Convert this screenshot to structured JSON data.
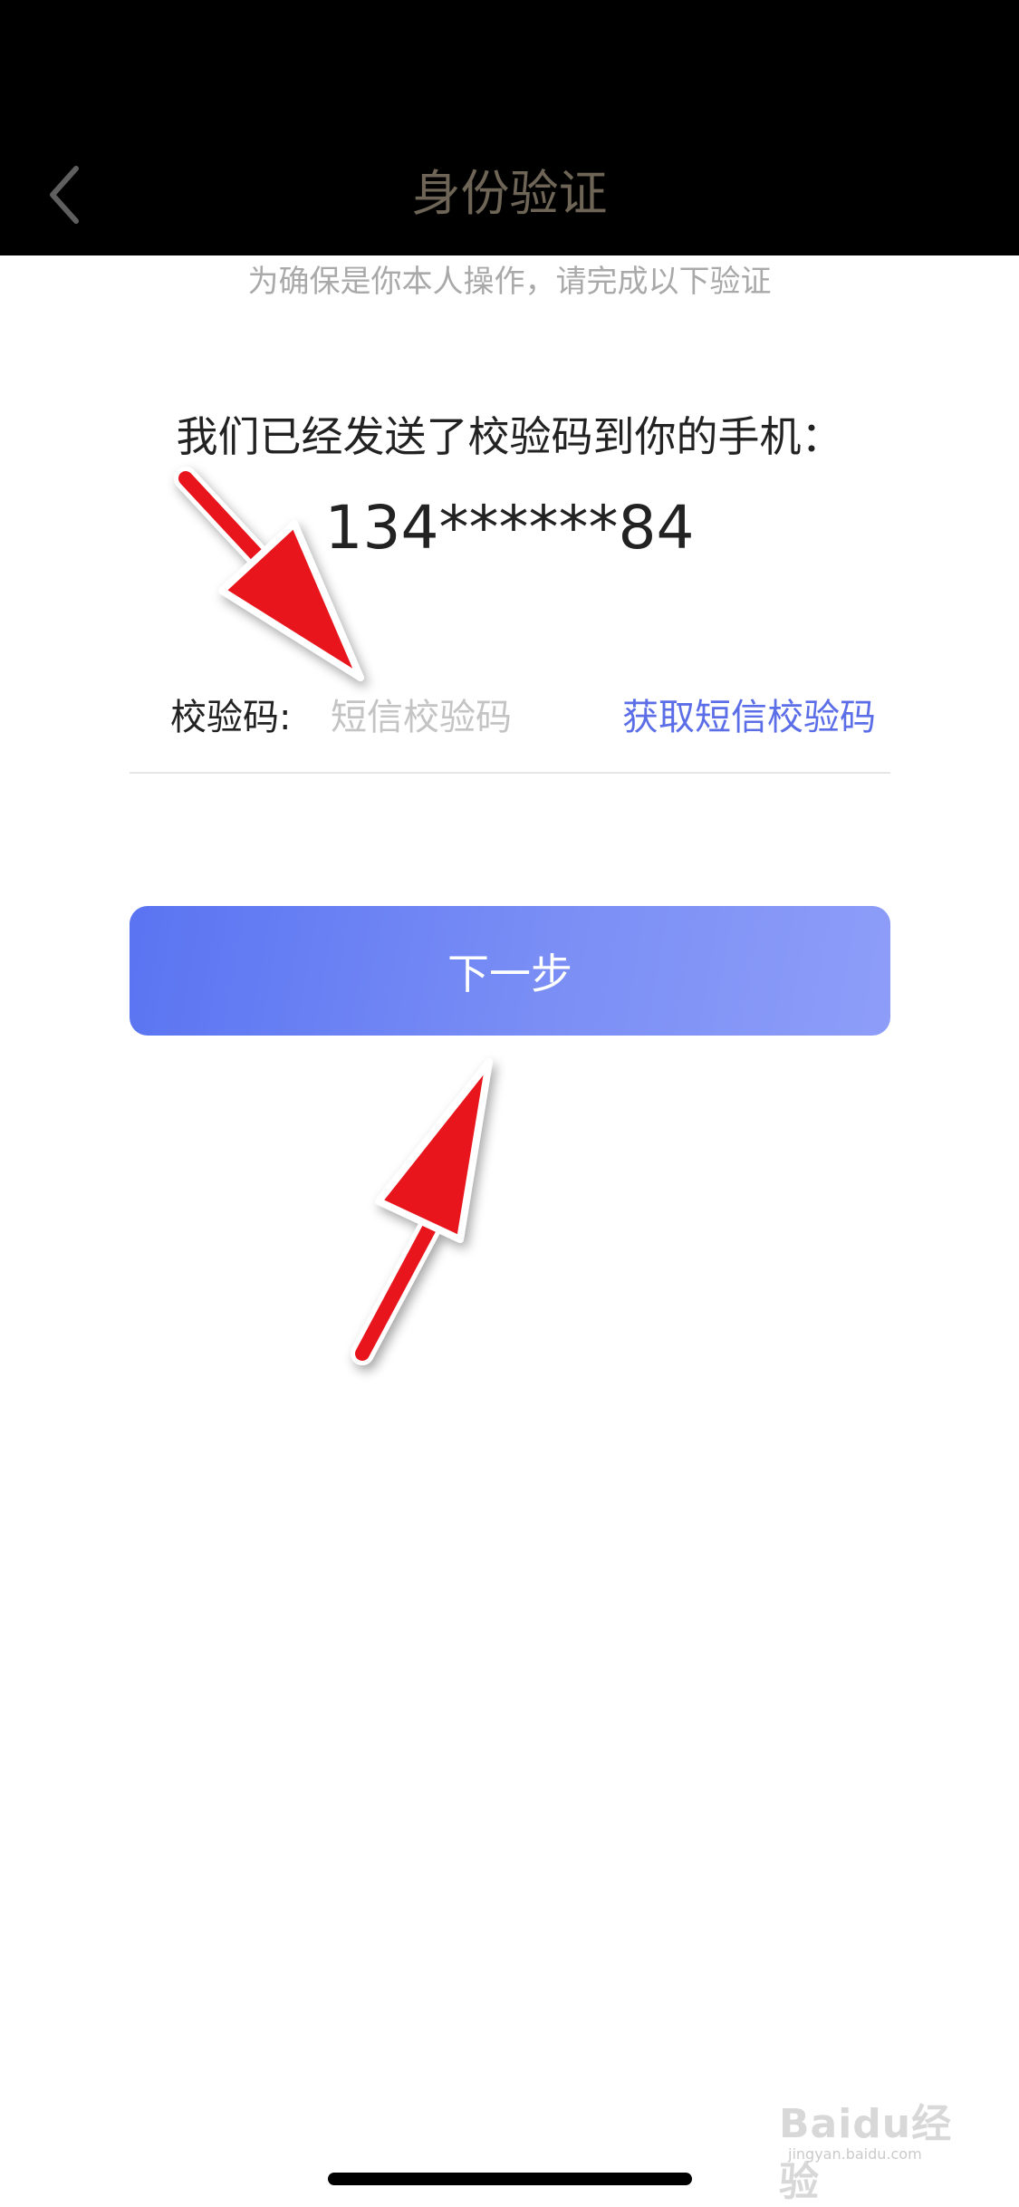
{
  "nav": {
    "title": "身份验证",
    "back_icon": "chevron-left-icon"
  },
  "subtitle": "为确保是你本人操作，请完成以下验证",
  "message": "我们已经发送了校验码到你的手机：",
  "phone": "134******84",
  "code_field": {
    "label": "校验码:",
    "placeholder": "短信校验码",
    "value": "",
    "get_code_label": "获取短信校验码"
  },
  "next_button": {
    "label": "下一步"
  },
  "annotations": {
    "arrow_color": "#ff0000",
    "arrow_icon": "red-arrow-icon"
  },
  "watermark": {
    "brand": "Baidu经验",
    "url": "jingyan.baidu.com"
  },
  "colors": {
    "accent": "#5b6ee8",
    "button_start": "#5a74f2",
    "button_end": "#8d9df8",
    "nav_background": "#000000",
    "nav_title": "#6e6557"
  }
}
